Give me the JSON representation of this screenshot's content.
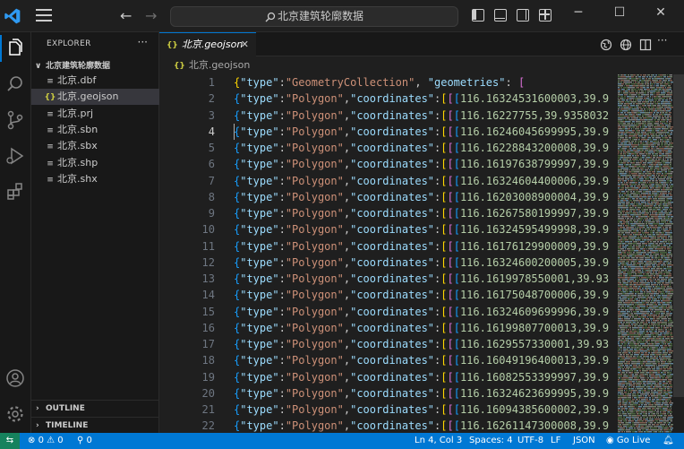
{
  "titlebar": {
    "search_text": "北京建筑轮廓数据"
  },
  "sidebar": {
    "title": "EXPLORER",
    "more": "···",
    "folder": "北京建筑轮廓数据",
    "files": [
      {
        "name": "北京.dbf",
        "icon": "≡"
      },
      {
        "name": "北京.geojson",
        "icon": "{}"
      },
      {
        "name": "北京.prj",
        "icon": "≡"
      },
      {
        "name": "北京.sbn",
        "icon": "≡"
      },
      {
        "name": "北京.sbx",
        "icon": "≡"
      },
      {
        "name": "北京.shp",
        "icon": "≡"
      },
      {
        "name": "北京.shx",
        "icon": "≡"
      }
    ],
    "outline": "OUTLINE",
    "timeline": "TIMELINE"
  },
  "editor": {
    "tab_label": "北京.geojson",
    "tab_icon": "{}",
    "tab_close": "✕",
    "breadcrumb": "北京.geojson",
    "breadcrumb_icon": "{}",
    "current_line": 4,
    "first_line": {
      "number": "1",
      "type_key": "\"type\"",
      "type_value": "\"GeometryCollection\"",
      "geom_key": "\"geometries\""
    },
    "polygon_key": "\"type\"",
    "polygon_value": "\"Polygon\"",
    "coords_key": "\"coordinates\"",
    "coord_lines": [
      {
        "number": "2",
        "value": "116.1632453160000",
        "tail": "3,39.9"
      },
      {
        "number": "3",
        "value": "116.16227755",
        "tail": ",39.9358032"
      },
      {
        "number": "4",
        "value": "116.1624604569999",
        "tail": "5,39.9"
      },
      {
        "number": "5",
        "value": "116.1622884320000",
        "tail": "8,39.9"
      },
      {
        "number": "6",
        "value": "116.1619763879999",
        "tail": "7,39.9"
      },
      {
        "number": "7",
        "value": "116.1632460440000",
        "tail": "6,39.9"
      },
      {
        "number": "8",
        "value": "116.1620300890000",
        "tail": "4,39.9"
      },
      {
        "number": "9",
        "value": "116.1626758019999",
        "tail": "7,39.9"
      },
      {
        "number": "10",
        "value": "116.1632459549999",
        "tail": "8,39.9"
      },
      {
        "number": "11",
        "value": "116.1617612990000",
        "tail": "9,39.9"
      },
      {
        "number": "12",
        "value": "116.1632460020000",
        "tail": "5,39.9"
      },
      {
        "number": "13",
        "value": "116.16199785500",
        "tail": "01,39.93"
      },
      {
        "number": "14",
        "value": "116.1617504870000",
        "tail": "6,39.9"
      },
      {
        "number": "15",
        "value": "116.1632460969999",
        "tail": "6,39.9"
      },
      {
        "number": "16",
        "value": "116.1619980770001",
        "tail": "3,39.9"
      },
      {
        "number": "17",
        "value": "116.16295573300",
        "tail": "01,39.93"
      },
      {
        "number": "18",
        "value": "116.1604919640001",
        "tail": "3,39.9"
      },
      {
        "number": "19",
        "value": "116.1608255339999",
        "tail": "7,39.9"
      },
      {
        "number": "20",
        "value": "116.1632462369999",
        "tail": "5,39.9"
      },
      {
        "number": "21",
        "value": "116.1609438560000",
        "tail": "2,39.9"
      },
      {
        "number": "22",
        "value": "116.1626114730000",
        "tail": "8,39.9"
      }
    ]
  },
  "statusbar": {
    "errors": "0",
    "warnings": "0",
    "ports": "0",
    "position": "Ln 4, Col 3",
    "spaces": "Spaces: 4",
    "encoding": "UTF-8",
    "eol": "LF",
    "language": "JSON",
    "golive": "Go Live"
  },
  "colors": {
    "accent": "#0078d4",
    "key": "#9cdcfe",
    "string": "#ce9178",
    "number": "#b5cea8",
    "bracket1": "#ffd700",
    "bracket2": "#da70d6",
    "bracket3": "#179fff"
  }
}
